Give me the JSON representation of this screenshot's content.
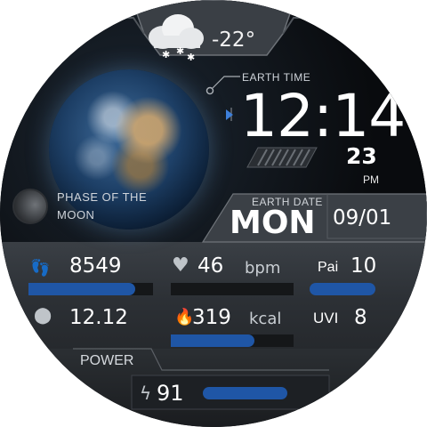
{
  "weather": {
    "icon": "snow-cloud-icon",
    "temperature": "-22°"
  },
  "time": {
    "label": "EARTH TIME",
    "hours_minutes": "12:14",
    "seconds": "23",
    "ampm": "PM"
  },
  "date": {
    "label": "EARTH DATE",
    "weekday": "MON",
    "month_day": "09/01"
  },
  "moon": {
    "label_line1": "PHASE OF THE",
    "label_line2": "MOON"
  },
  "stats": {
    "steps": {
      "value": "8549",
      "icon": "footprints-icon",
      "progress": 0.86
    },
    "heart": {
      "value": "46",
      "unit": "bpm",
      "icon": "heart-icon",
      "progress": 0.0
    },
    "pai": {
      "label": "Pai",
      "value": "10",
      "progress": 0.95
    },
    "distance": {
      "value": "12.12",
      "icon": "location-pin-icon"
    },
    "calories": {
      "value": "319",
      "unit": "kcal",
      "icon": "flame-icon",
      "progress": 0.68
    },
    "uvi": {
      "label": "UVI",
      "value": "8"
    }
  },
  "power": {
    "label": "POWER",
    "value": "91",
    "icon": "lightning-icon",
    "progress": 0.91
  },
  "colors": {
    "accent_blue": "#1f56a6",
    "background": "#0b0d10",
    "panel": "#2c3035"
  }
}
